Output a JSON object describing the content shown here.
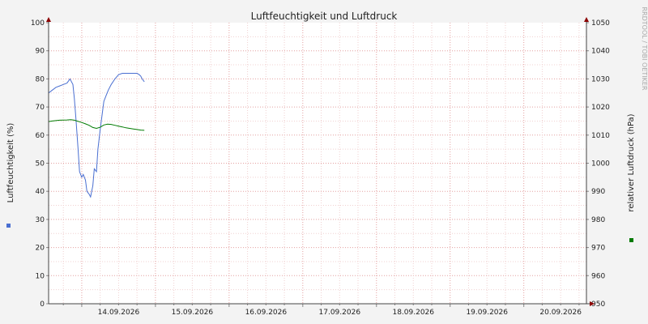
{
  "chart_data": {
    "type": "line",
    "title": "Luftfeuchtigkeit und Luftdruck",
    "ylabel_left": "Luftfeuchtigkeit (%)",
    "ylabel_right": "relativer Luftdruck (hPa)",
    "watermark": "RRDTOOL / TOBI OETIKER",
    "ylim_left": [
      0,
      100
    ],
    "ylim_right": [
      950,
      1050
    ],
    "yticks_left": [
      "0",
      "10",
      "20",
      "30",
      "40",
      "50",
      "60",
      "70",
      "80",
      "90",
      "100"
    ],
    "yticks_right": [
      "950",
      "960",
      "970",
      "980",
      "990",
      "1000",
      "1010",
      "1020",
      "1030",
      "1040",
      "1050"
    ],
    "x_dates": [
      "14.09.2026",
      "15.09.2026",
      "16.09.2026",
      "17.09.2026",
      "18.09.2026",
      "19.09.2026",
      "20.09.2026"
    ],
    "xlim_days": [
      13.55,
      20.85
    ],
    "grid": true,
    "colors": {
      "humidity": "#4a6fd1",
      "pressure": "#007a00",
      "background": "#f3f3f3",
      "plot_bg": "#ffffff",
      "grid": "#e4a0a0",
      "arrow": "#8b0000"
    },
    "series": [
      {
        "axis": "left",
        "x": [
          13.55,
          13.6,
          13.65,
          13.7,
          13.75,
          13.8,
          13.84,
          13.88,
          13.9,
          13.92,
          13.95,
          13.97,
          14.0,
          14.02,
          14.05,
          14.07,
          14.1,
          14.12,
          14.15,
          14.17,
          14.2,
          14.22,
          14.25,
          14.28,
          14.3,
          14.33,
          14.36,
          14.4,
          14.45,
          14.5,
          14.55,
          14.6,
          14.65,
          14.7,
          14.75,
          14.78,
          14.8,
          14.82,
          14.85
        ],
        "values": [
          75,
          76,
          77,
          77.5,
          78,
          78.5,
          80,
          78,
          73,
          66,
          55,
          47,
          45,
          46,
          44,
          40,
          39,
          38,
          42,
          48,
          47,
          55,
          62,
          68,
          72,
          74,
          76,
          78,
          80,
          81.5,
          82,
          82,
          82,
          82,
          82,
          81.5,
          81,
          80,
          79
        ]
      },
      {
        "axis": "right",
        "x": [
          13.55,
          13.6,
          13.7,
          13.8,
          13.85,
          13.9,
          14.0,
          14.05,
          14.1,
          14.15,
          14.2,
          14.25,
          14.3,
          14.35,
          14.4,
          14.45,
          14.5,
          14.55,
          14.6,
          14.65,
          14.7,
          14.75,
          14.8,
          14.85
        ],
        "values": [
          1014.8,
          1015,
          1015.3,
          1015.4,
          1015.5,
          1015.3,
          1014.5,
          1014.0,
          1013.5,
          1012.7,
          1012.4,
          1012.8,
          1013.6,
          1013.9,
          1013.8,
          1013.5,
          1013.2,
          1012.9,
          1012.6,
          1012.4,
          1012.2,
          1012.0,
          1011.8,
          1011.7
        ]
      }
    ]
  }
}
